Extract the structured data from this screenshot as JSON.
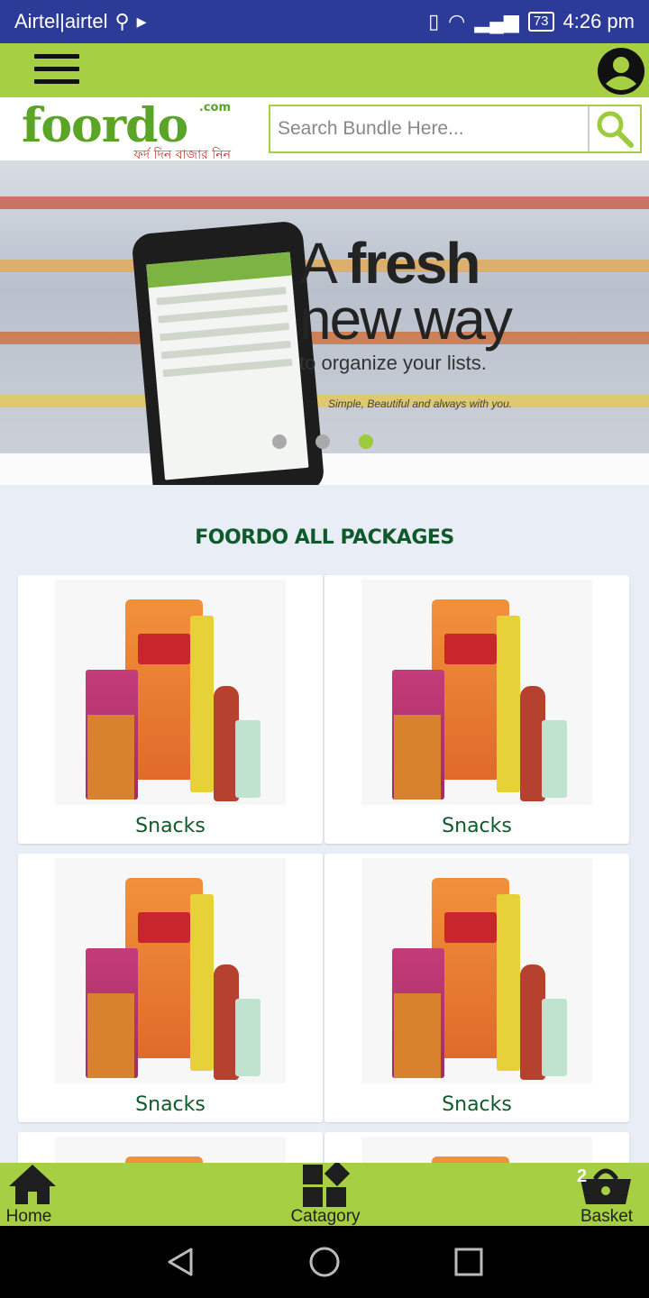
{
  "status_bar": {
    "carrier": "Airtel|airtel",
    "battery": "73",
    "time": "4:26 pm"
  },
  "header": {
    "logo_text": "foordo",
    "logo_com": ".com",
    "logo_tagline": "ফর্দ দিন বাজার নিন"
  },
  "search": {
    "placeholder": "Search Bundle Here..."
  },
  "banner": {
    "headline_1a": "A ",
    "headline_1b": "fresh",
    "headline_2": "new way",
    "subline": "to organize your lists.",
    "tagline": "Simple, Beautiful and always with you.",
    "slides": 3,
    "active_slide": 3
  },
  "section_title": "FOORDO ALL PACKAGES",
  "packages": [
    {
      "label": "Snacks"
    },
    {
      "label": "Snacks"
    },
    {
      "label": "Snacks"
    },
    {
      "label": "Snacks"
    }
  ],
  "bottom_nav": {
    "home": "Home",
    "category": "Catagory",
    "basket": "Basket",
    "basket_count": "2"
  },
  "colors": {
    "accent_green": "#a6cf44",
    "status_bar_blue": "#2c3b98",
    "title_green": "#0f5a2b"
  }
}
